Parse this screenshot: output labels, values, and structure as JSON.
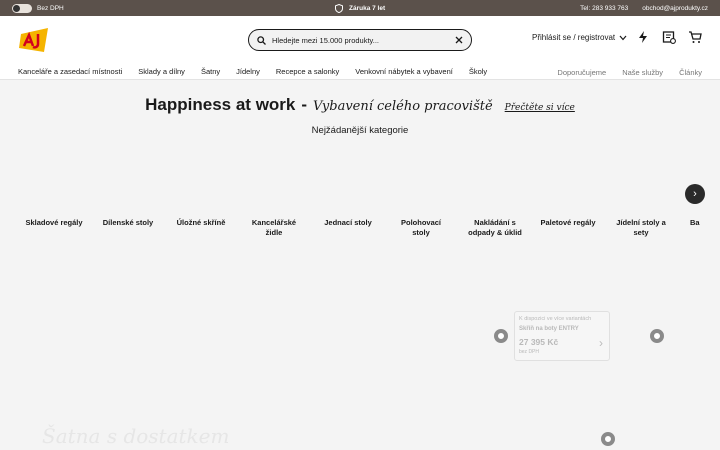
{
  "topbar": {
    "vat_toggle_label": "Bez DPH",
    "warranty": "Záruka 7 let",
    "phone": "Tel: 283 933 763",
    "email": "obchod@ajprodukty.cz"
  },
  "header": {
    "search_placeholder": "Hledejte mezi 15.000 produkty...",
    "login": "Přihlásit se / registrovat"
  },
  "nav": {
    "items": [
      "Kanceláře a zasedací místnosti",
      "Sklady a dílny",
      "Šatny",
      "Jídelny",
      "Recepce a salonky",
      "Venkovní nábytek a vybavení",
      "Školy"
    ],
    "right": [
      "Doporučujeme",
      "Naše služby",
      "Články"
    ]
  },
  "hero": {
    "title": "Happiness at work",
    "dash": "-",
    "subtitle": "Vybavení celého pracoviště",
    "link": "Přečtěte si více"
  },
  "categories_heading": "Nejžádanější kategorie",
  "categories": [
    "Skladové regály",
    "Dílenské stoly",
    "Úložné skříně",
    "Kancelářské židle",
    "Jednací stoly",
    "Polohovací stoly",
    "Nakládání s odpady & úklid",
    "Paletové regály",
    "Jídelní stoly a sety",
    "Ba"
  ],
  "carousel_next": "›",
  "product_card": {
    "availability": "K dispozici ve více variantách",
    "title": "Skříň na boty ENTRY",
    "price": "27 395 Kč",
    "vat": "bez DPH",
    "chevron": "›"
  },
  "bottom_title": "Šatna s dostatkem"
}
